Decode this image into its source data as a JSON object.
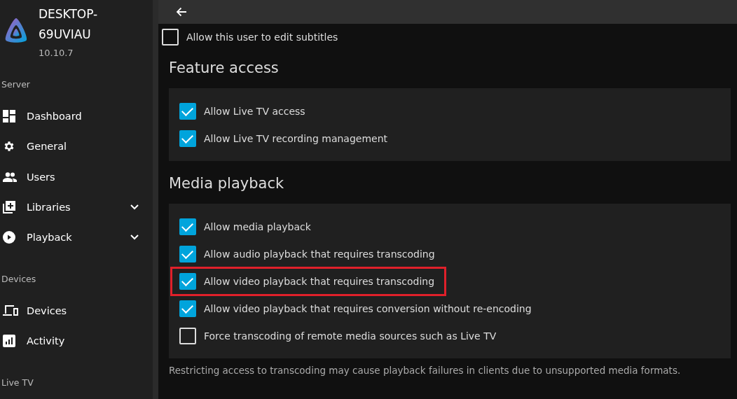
{
  "server": {
    "name": "DESKTOP-69UVIAU",
    "version": "10.10.7"
  },
  "sidebar": [
    {
      "kind": "header",
      "label": "Server"
    },
    {
      "kind": "item",
      "label": "Dashboard",
      "expandable": false
    },
    {
      "kind": "item",
      "label": "General",
      "expandable": false
    },
    {
      "kind": "item",
      "label": "Users",
      "expandable": false
    },
    {
      "kind": "item",
      "label": "Libraries",
      "expandable": true
    },
    {
      "kind": "item",
      "label": "Playback",
      "expandable": true
    },
    {
      "kind": "header",
      "label": "Devices"
    },
    {
      "kind": "item",
      "label": "Devices",
      "expandable": false
    },
    {
      "kind": "item",
      "label": "Activity",
      "expandable": false
    },
    {
      "kind": "header",
      "label": "Live TV"
    }
  ],
  "top_option": {
    "label": "Allow this user to edit subtitles",
    "checked": false
  },
  "sections": [
    {
      "title": "Feature access",
      "options": [
        {
          "label": "Allow Live TV access",
          "checked": true,
          "highlighted": false
        },
        {
          "label": "Allow Live TV recording management",
          "checked": true,
          "highlighted": false
        }
      ]
    },
    {
      "title": "Media playback",
      "options": [
        {
          "label": "Allow media playback",
          "checked": true,
          "highlighted": false
        },
        {
          "label": "Allow audio playback that requires transcoding",
          "checked": true,
          "highlighted": false
        },
        {
          "label": "Allow video playback that requires transcoding",
          "checked": true,
          "highlighted": true
        },
        {
          "label": "Allow video playback that requires conversion without re-encoding",
          "checked": true,
          "highlighted": false
        },
        {
          "label": "Force transcoding of remote media sources such as Live TV",
          "checked": false,
          "highlighted": false
        }
      ],
      "note": "Restricting access to transcoding may cause playback failures in clients due to unsupported media formats."
    }
  ]
}
